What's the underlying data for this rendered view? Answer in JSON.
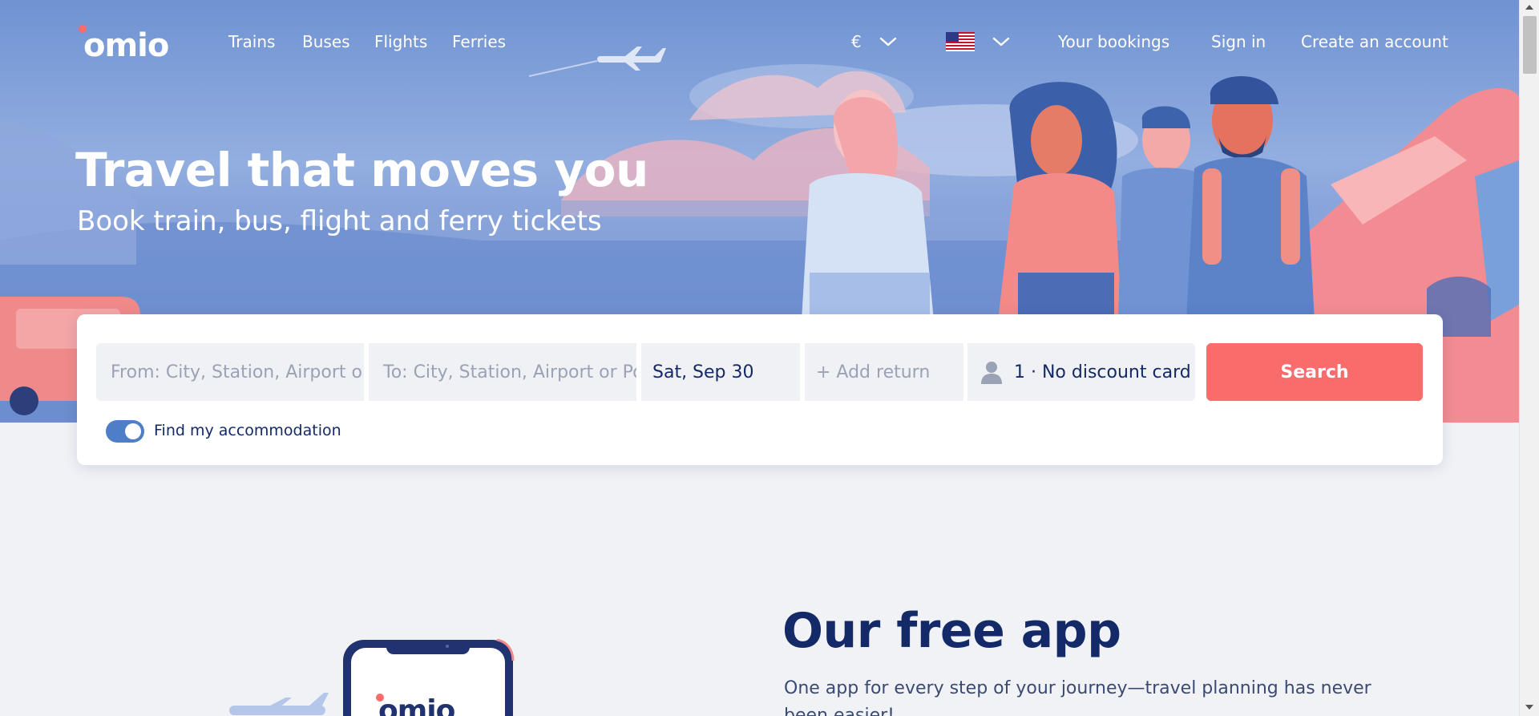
{
  "nav": {
    "links": [
      "Trains",
      "Buses",
      "Flights",
      "Ferries"
    ],
    "currency": "€",
    "right_links": [
      "Your bookings",
      "Sign in",
      "Create an account"
    ]
  },
  "hero": {
    "headline": "Travel that moves you",
    "subline": "Book train, bus, flight and ferry tickets"
  },
  "search": {
    "from_placeholder": "From: City, Station, Airport or Port",
    "to_placeholder": "To: City, Station, Airport or Port",
    "date_value": "Sat, Sep 30",
    "return_placeholder": "+ Add return",
    "passengers_value": "1 · No discount card",
    "search_label": "Search",
    "accommodation_toggle_label": "Find my accommodation",
    "accommodation_toggle_on": true
  },
  "app_section": {
    "title": "Our free app",
    "description": "One app for every step of your journey—travel planning has never been easier!"
  },
  "colors": {
    "brand_red": "#fa6b6b",
    "navy": "#132968",
    "hero_blue": "#7d9bd5",
    "toggle_blue": "#4f7ec9"
  },
  "icons": [
    "omio-logo",
    "chevron-down-icon",
    "us-flag-icon",
    "person-icon"
  ]
}
